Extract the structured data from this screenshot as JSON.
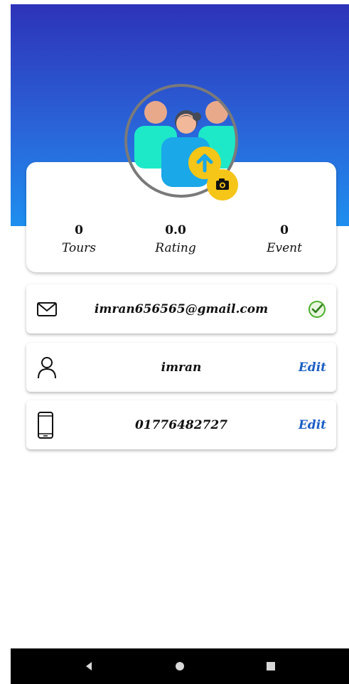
{
  "profile": {
    "avatar_alt": "group avatar",
    "upload_icon": "arrow-up-icon",
    "camera_icon": "camera-icon"
  },
  "stats": [
    {
      "value": "0",
      "label": "Tours"
    },
    {
      "value": "0.0",
      "label": "Rating"
    },
    {
      "value": "0",
      "label": "Event"
    }
  ],
  "email": {
    "icon": "mail-icon",
    "value": "imran656565@gmail.com",
    "status_icon": "verified-check-icon"
  },
  "name": {
    "icon": "person-icon",
    "value": "imran",
    "action": "Edit"
  },
  "phone": {
    "icon": "phone-icon",
    "value": "01776482727",
    "action": "Edit"
  },
  "navbar": {
    "back": "back-icon",
    "home": "home-icon",
    "recent": "recent-apps-icon"
  },
  "colors": {
    "header_top": "#2d33b8",
    "header_bottom": "#1e8fef",
    "accent_yellow": "#f5c518",
    "edit_link": "#1b5fc4",
    "verified_green": "#4caf2a"
  }
}
